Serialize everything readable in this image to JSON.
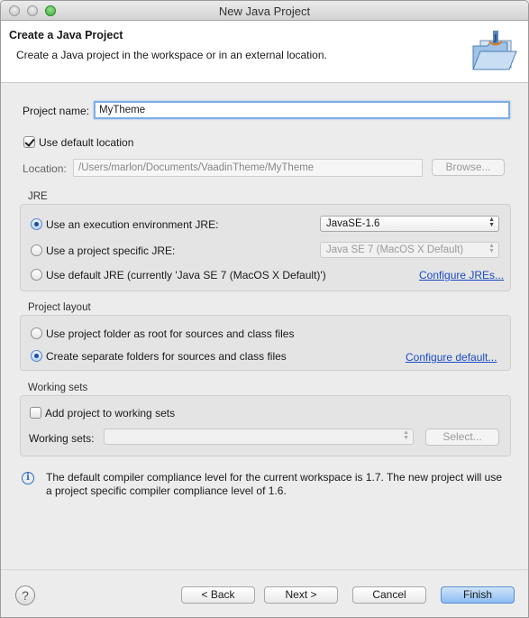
{
  "window": {
    "title": "New Java Project"
  },
  "header": {
    "title": "Create a Java Project",
    "description": "Create a Java project in the workspace or in an external location.",
    "icon": "java-project-wizard-icon"
  },
  "project": {
    "name_label": "Project name:",
    "name_value": "MyTheme",
    "use_default_location_label": "Use default location",
    "use_default_location_checked": true,
    "location_label": "Location:",
    "location_value": "/Users/marlon/Documents/VaadinTheme/MyTheme",
    "browse_label": "Browse..."
  },
  "jre": {
    "group_label": "JRE",
    "options": [
      {
        "label": "Use an execution environment JRE:",
        "selected": true
      },
      {
        "label": "Use a project specific JRE:",
        "selected": false
      },
      {
        "label": "Use default JRE (currently 'Java SE 7 (MacOS X Default)')",
        "selected": false
      }
    ],
    "execution_env_value": "JavaSE-1.6",
    "project_jre_value": "Java SE 7 (MacOS X Default)",
    "configure_link": "Configure JREs..."
  },
  "layout": {
    "group_label": "Project layout",
    "options": [
      {
        "label": "Use project folder as root for sources and class files",
        "selected": false
      },
      {
        "label": "Create separate folders for sources and class files",
        "selected": true
      }
    ],
    "configure_link": "Configure default..."
  },
  "working_sets": {
    "group_label": "Working sets",
    "add_label": "Add project to working sets",
    "add_checked": false,
    "sets_label": "Working sets:",
    "sets_value": "",
    "select_label": "Select..."
  },
  "info": {
    "icon": "info-icon",
    "message": "The default compiler compliance level for the current workspace is 1.7. The new project will use a project specific compiler compliance level of 1.6."
  },
  "footer": {
    "help_icon": "help-icon",
    "back_label": "< Back",
    "next_label": "Next >",
    "cancel_label": "Cancel",
    "finish_label": "Finish"
  }
}
